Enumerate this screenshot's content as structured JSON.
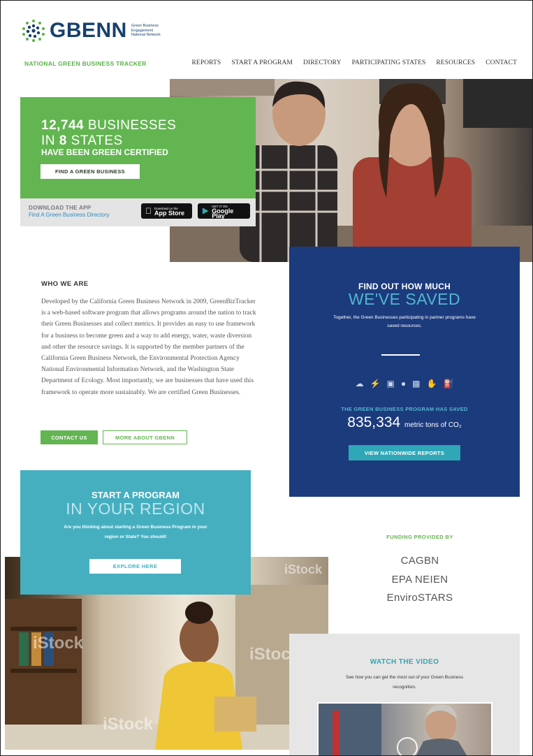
{
  "header": {
    "logo_text": "GBENN",
    "logo_tagline": [
      "Green Business",
      "Engagement",
      "National Network"
    ],
    "tracker_label": "NATIONAL GREEN BUSINESS TRACKER",
    "nav": [
      "REPORTS",
      "START A PROGRAM",
      "DIRECTORY",
      "PARTICIPATING STATES",
      "RESOURCES",
      "CONTACT"
    ]
  },
  "hero": {
    "count_number": "12,744",
    "count_suffix": "BUSINESSES",
    "states_prefix": "IN",
    "states_number": "8",
    "states_suffix": "STATES",
    "subtitle": "HAVE BEEN GREEN CERTIFIED",
    "button": "FIND A GREEN BUSINESS",
    "download_label": "DOWNLOAD THE APP",
    "download_link": "Find A Green Business Directory",
    "app_store_small": "Download on the",
    "app_store_big": "App Store",
    "google_play_small": "GET IT ON",
    "google_play_big": "Google Play"
  },
  "who": {
    "title": "WHO WE ARE",
    "text": "Developed by the California Green Business Network in 2009, GreenBizTracker is a web-based software program that allows programs around the nation to track their Green Businesses and collect metrics. It provides an easy to use framework for a business to become green and a way to add energy, water, waste diversion and other the resource savings. It is supported by the member partners of the California Green Business Network, the Environmental Protection Agency National Environmental Information Network, and the Washington State Department of Ecology. Most importantly, we are businesses that have used this framework to operate more sustainably. We are certified Green Businesses.",
    "contact_button": "CONTACT US",
    "more_button": "MORE ABOUT GBENN"
  },
  "saved": {
    "pre_title": "FIND OUT HOW MUCH",
    "title": "WE'VE SAVED",
    "description": "Together, the Green Businesses participating in partner programs have saved resources.",
    "program_label": "THE GREEN BUSINESS PROGRAM HAS SAVED",
    "value": "835,334",
    "unit": "metric tons of CO₂",
    "button": "VIEW NATIONWIDE REPORTS",
    "icons": [
      "cloud-icon",
      "plug-icon",
      "trash-icon",
      "water-drop-icon",
      "recycle-bin-icon",
      "hand-icon",
      "gas-pump-icon"
    ]
  },
  "start": {
    "title": "START A PROGRAM",
    "subtitle": "IN YOUR REGION",
    "description": "Are you thinking about starting a Green Business Program in your region or State? You should!",
    "button": "EXPLORE HERE"
  },
  "funding": {
    "label": "FUNDING PROVIDED BY",
    "items": [
      "CAGBN",
      "EPA NEIEN",
      "EnviroSTARS"
    ]
  },
  "video": {
    "title": "WATCH THE VIDEO",
    "description": "See how you can get the most out of your Green Business recognition."
  },
  "watermark": "iStock",
  "colors": {
    "green": "#62b550",
    "navy": "#1c3b7d",
    "teal": "#45afc0",
    "logo_blue": "#17406d"
  }
}
